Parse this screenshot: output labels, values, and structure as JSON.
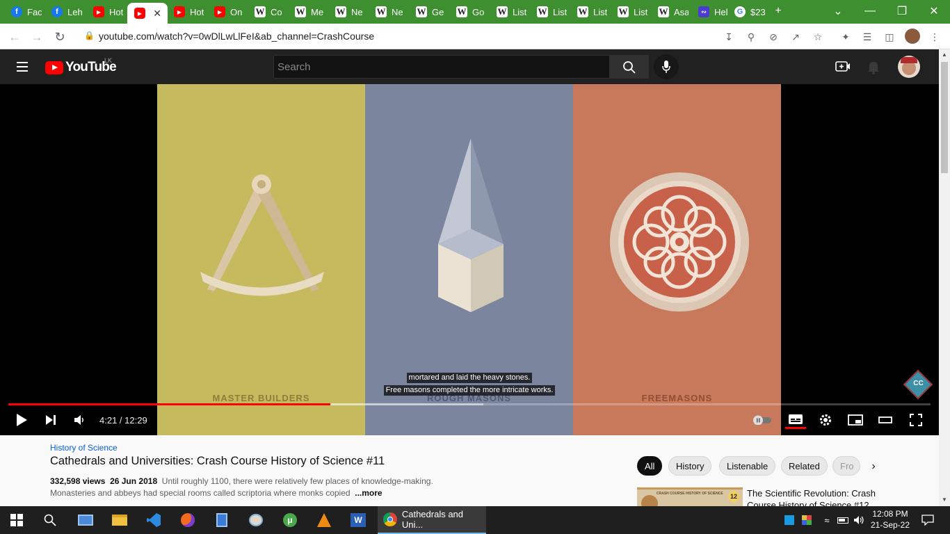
{
  "browser": {
    "tabs": [
      {
        "icon": "facebook-icon",
        "label": "Fac"
      },
      {
        "icon": "facebook-icon",
        "label": "Leh"
      },
      {
        "icon": "youtube-icon",
        "label": "Hot"
      },
      {
        "icon": "youtube-icon",
        "label": "",
        "active": true
      },
      {
        "icon": "youtube-icon",
        "label": "Hot"
      },
      {
        "icon": "youtube-icon",
        "label": "On"
      },
      {
        "icon": "wikipedia-icon",
        "label": "Co"
      },
      {
        "icon": "wikipedia-icon",
        "label": "Me"
      },
      {
        "icon": "wikipedia-icon",
        "label": "Ne"
      },
      {
        "icon": "wikipedia-icon",
        "label": "Ne"
      },
      {
        "icon": "wikipedia-icon",
        "label": "Ge"
      },
      {
        "icon": "wikipedia-icon",
        "label": "Go"
      },
      {
        "icon": "wikipedia-icon",
        "label": "List"
      },
      {
        "icon": "wikipedia-icon",
        "label": "List"
      },
      {
        "icon": "wikipedia-icon",
        "label": "List"
      },
      {
        "icon": "wikipedia-icon",
        "label": "List"
      },
      {
        "icon": "wikipedia-icon",
        "label": "Asa"
      },
      {
        "icon": "hf-icon",
        "label": "Hel"
      },
      {
        "icon": "google-icon",
        "label": "$23"
      }
    ],
    "new_tab": "+",
    "url": "youtube.com/watch?v=0wDlLwLlFeI&ab_channel=CrashCourse",
    "colors": {
      "tabstrip": "#3d8f2f"
    }
  },
  "youtube": {
    "logo_text": "YouTube",
    "region": "LK",
    "search_placeholder": "Search"
  },
  "player": {
    "panels": [
      {
        "label": "MASTER BUILDERS",
        "color": "#c5ba5e",
        "text_color": "#8a7f3a"
      },
      {
        "label": "ROUGH MASONS",
        "color": "#7b869e",
        "text_color": "#4f5a72"
      },
      {
        "label": "FREEMASONS",
        "color": "#c9795b",
        "text_color": "#8e4f35"
      }
    ],
    "captions": [
      "mortared and laid the heavy stones.",
      "Free masons completed the more intricate works."
    ],
    "time": "4:21 / 12:29",
    "progress_played_percent": 34.9,
    "progress_buffered_percent": 51.5,
    "channel_badge": "CC"
  },
  "video": {
    "category": "History of Science",
    "title": "Cathedrals and Universities: Crash Course History of Science #11",
    "views": "332,598 views",
    "date": "26 Jun 2018",
    "description": "Until roughly 1100, there were relatively few places of knowledge-making. Monasteries and abbeys had special rooms called scriptoria where monks copied",
    "more_label": "...more"
  },
  "chips": [
    "All",
    "History",
    "Listenable",
    "Related",
    "Fro"
  ],
  "recommended": {
    "title": "The Scientific Revolution: Crash Course History of Science #12",
    "badge": "12"
  },
  "taskbar": {
    "active_window": "Cathedrals and Uni...",
    "time": "12:08 PM",
    "date": "21-Sep-22"
  }
}
